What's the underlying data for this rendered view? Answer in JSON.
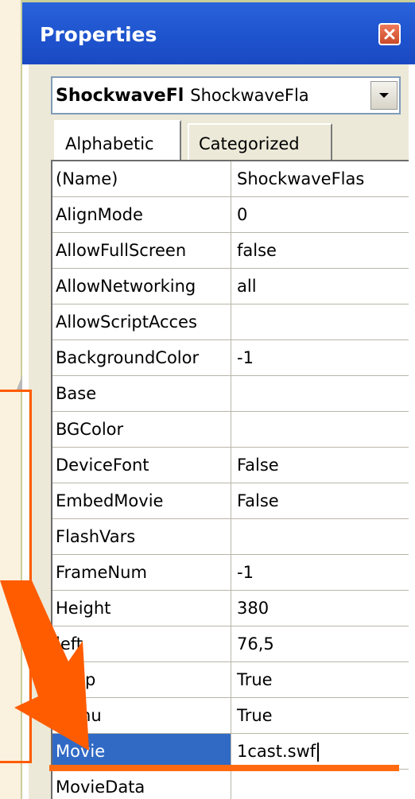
{
  "window": {
    "title": "Properties",
    "close_icon": "close-icon"
  },
  "object_selector": {
    "name": "ShockwaveFl",
    "type": "ShockwaveFla",
    "dropdown_icon": "chevron-down-icon"
  },
  "tabs": [
    {
      "label": "Alphabetic",
      "selected": true
    },
    {
      "label": "Categorized",
      "selected": false
    }
  ],
  "properties": [
    {
      "name": "(Name)",
      "value": "ShockwaveFlas"
    },
    {
      "name": "AlignMode",
      "value": "0"
    },
    {
      "name": "AllowFullScreen",
      "value": "false"
    },
    {
      "name": "AllowNetworking",
      "value": "all"
    },
    {
      "name": "AllowScriptAcces",
      "value": ""
    },
    {
      "name": "BackgroundColor",
      "value": "-1"
    },
    {
      "name": "Base",
      "value": ""
    },
    {
      "name": "BGColor",
      "value": ""
    },
    {
      "name": "DeviceFont",
      "value": "False"
    },
    {
      "name": "EmbedMovie",
      "value": "False"
    },
    {
      "name": "FlashVars",
      "value": ""
    },
    {
      "name": "FrameNum",
      "value": "-1"
    },
    {
      "name": "Height",
      "value": "380"
    },
    {
      "name": "left",
      "value": "76,5"
    },
    {
      "name": "Loop",
      "value": "True"
    },
    {
      "name": "Menu",
      "value": "True"
    },
    {
      "name": "Movie",
      "value": "1cast.swf",
      "selected": true
    },
    {
      "name": "MovieData",
      "value": ""
    }
  ],
  "colors": {
    "titlebar": "#1f55cf",
    "selection": "#316ac5",
    "annotation": "#ff5c00",
    "background": "#fbf1df"
  }
}
